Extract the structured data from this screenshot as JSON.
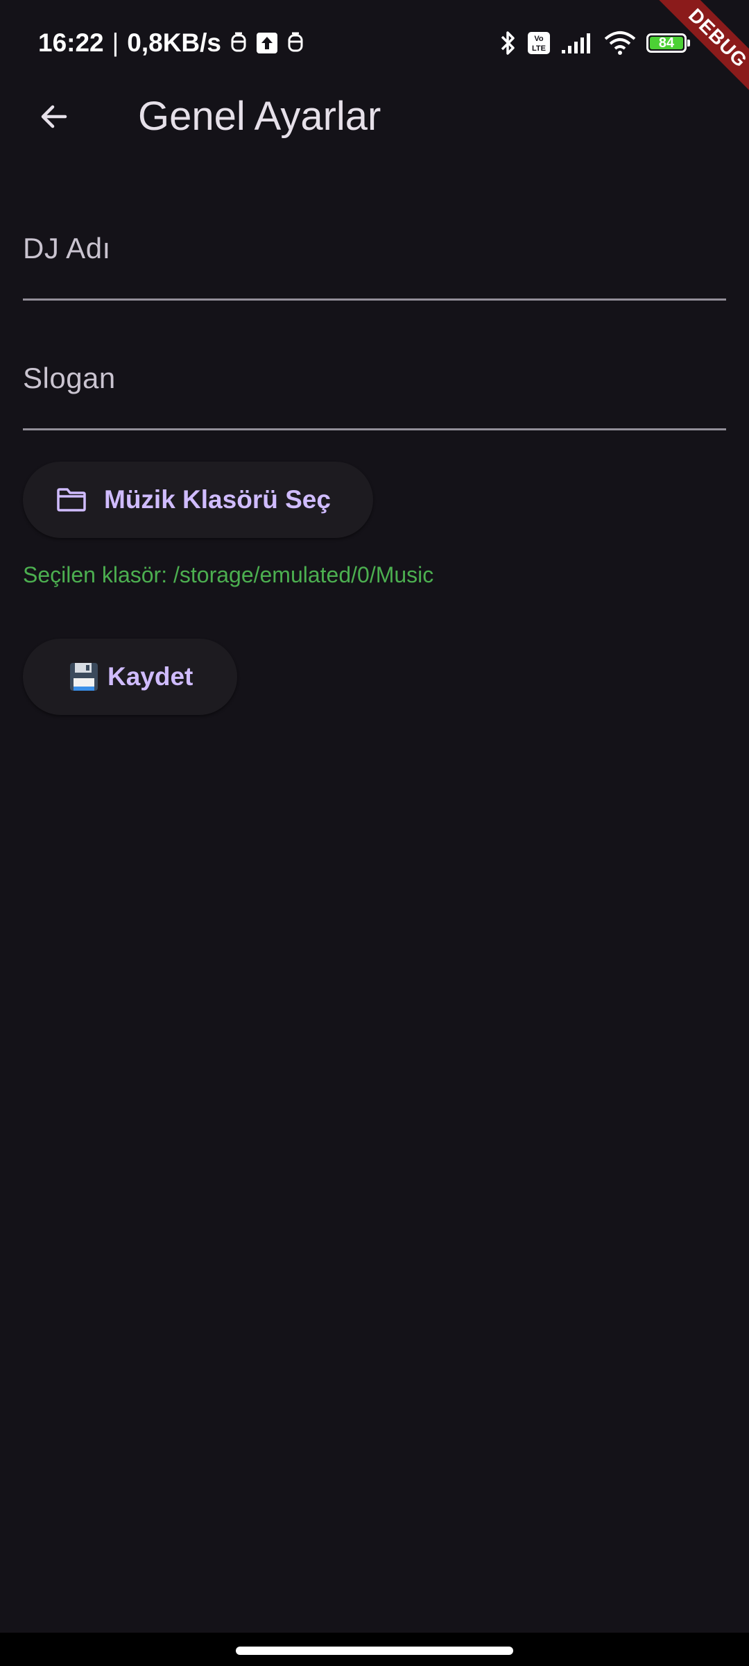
{
  "status_bar": {
    "time": "16:22",
    "separator": "|",
    "network_speed": "0,8KB/s",
    "left_icons": [
      "notification-icon",
      "upload-icon",
      "notification-icon"
    ],
    "right_icons": [
      "bluetooth-icon",
      "volte-icon",
      "signal-icon",
      "wifi-icon",
      "battery-icon"
    ],
    "volte_label": "Vo LTE",
    "battery_level": "84",
    "battery_color": "#4cd135"
  },
  "debug_banner": {
    "label": "DEBUG",
    "color": "#8b1b1b"
  },
  "app_bar": {
    "back_icon": "arrow-back-icon",
    "title": "Genel Ayarlar"
  },
  "form": {
    "dj_name": {
      "label": "DJ Adı",
      "value": ""
    },
    "slogan": {
      "label": "Slogan",
      "value": ""
    },
    "folder_button": {
      "icon": "folder-icon",
      "label": "Müzik Klasörü Seç"
    },
    "selected_folder_text": "Seçilen klasör: /storage/emulated/0/Music",
    "save_button": {
      "icon": "floppy-disk-icon",
      "label": "Kaydet"
    }
  },
  "colors": {
    "background": "#141218",
    "accent": "#d0bcff",
    "success": "#4caf50",
    "button_surface": "#1d1b20"
  }
}
